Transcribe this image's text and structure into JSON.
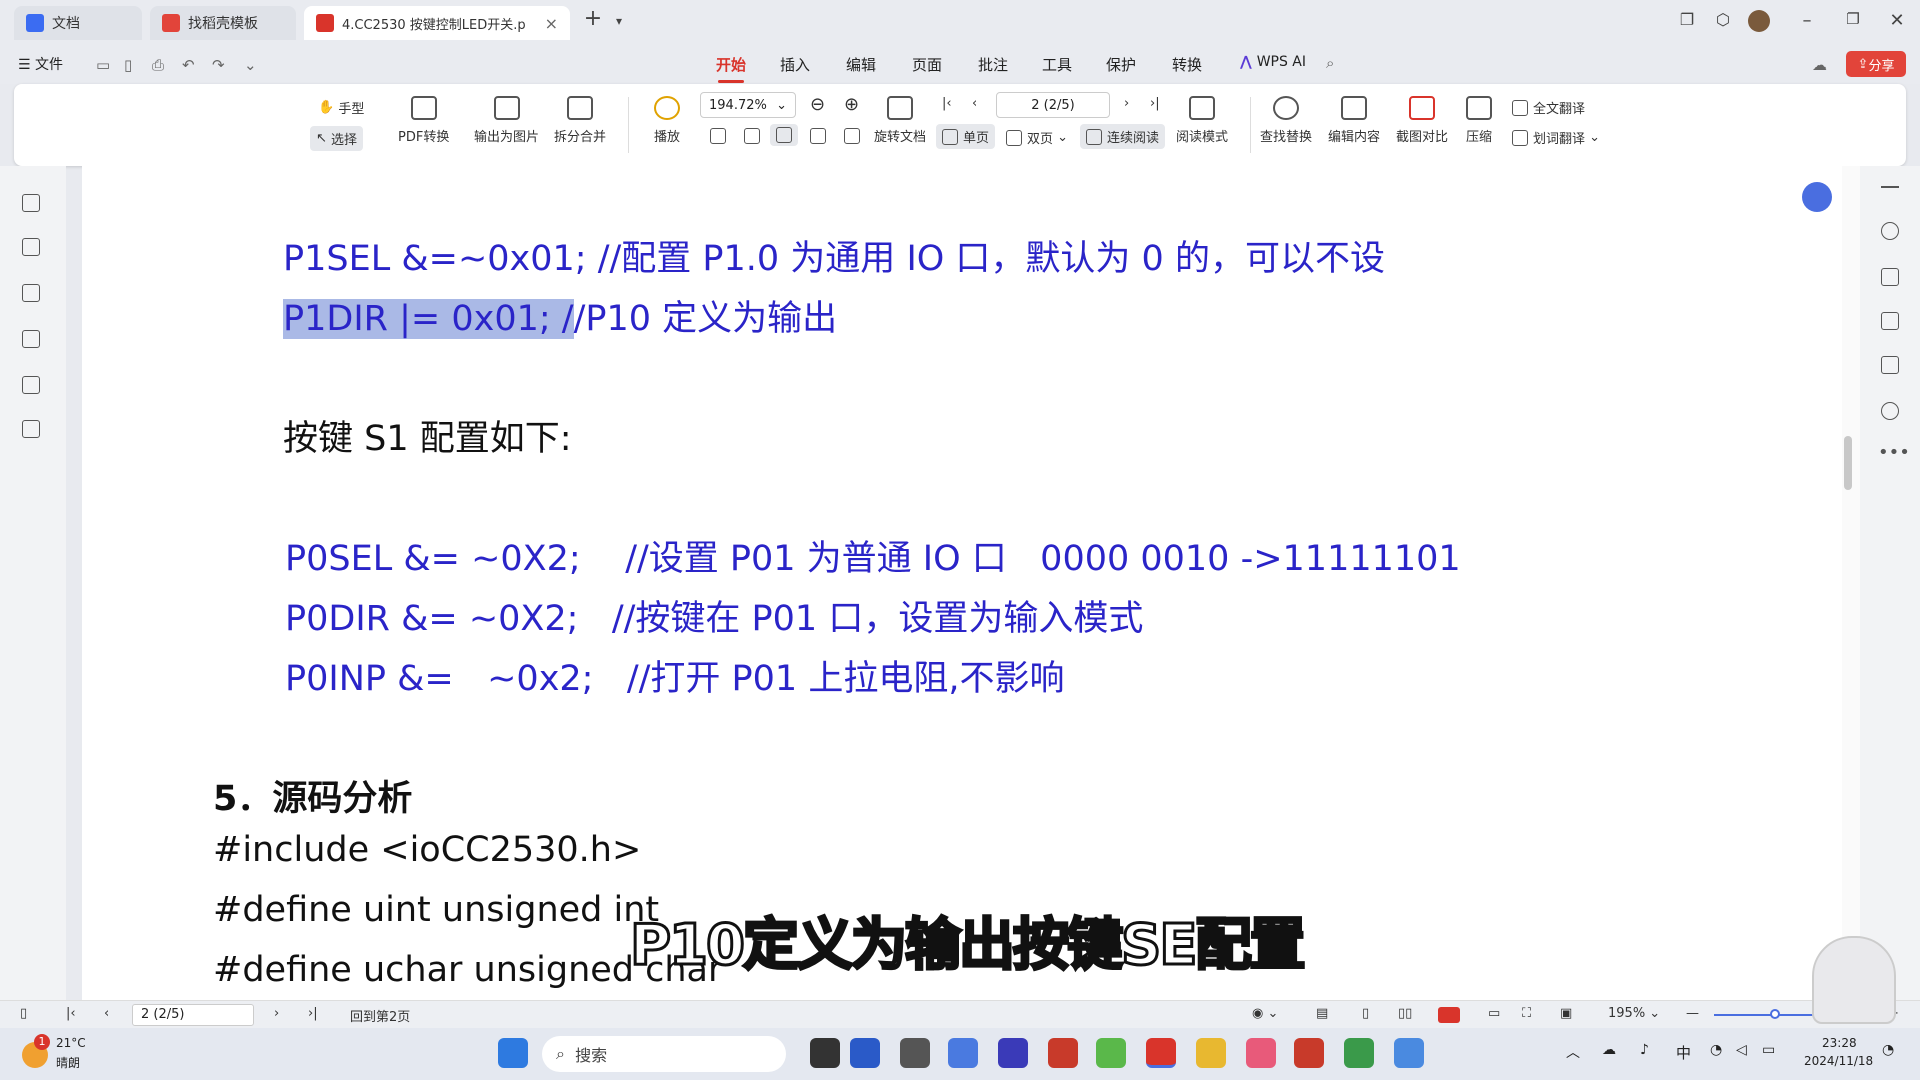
{
  "titlebar": {
    "tabs": [
      {
        "label": "文档",
        "color": "#3b6cf2"
      },
      {
        "label": "找稻壳模板",
        "color": "#e2443a"
      },
      {
        "label": "4.CC2530 按键控制LED开关.p",
        "color": "#d9342b"
      }
    ],
    "new_tab": "+"
  },
  "menubar": {
    "file": "文件",
    "items": [
      "开始",
      "插入",
      "编辑",
      "页面",
      "批注",
      "工具",
      "保护",
      "转换"
    ],
    "ai": "WPS AI",
    "share": "分享"
  },
  "ribbon": {
    "hand": "手型",
    "select": "选择",
    "pdf_convert": "PDF转换",
    "export_image": "输出为图片",
    "split_merge": "拆分合并",
    "play": "播放",
    "zoom": "194.72%",
    "rotate": "旋转文档",
    "page_field": "2 (2/5)",
    "single": "单页",
    "double": "双页",
    "continuous": "连续阅读",
    "read_mode": "阅读模式",
    "find_replace": "查找替换",
    "edit_content": "编辑内容",
    "screenshot_compare": "截图对比",
    "compress": "压缩",
    "full_translate": "全文翻译",
    "word_translate": "划词翻译"
  },
  "document": {
    "line1": "P1SEL &=~0x01; //配置 P1.0 为通用 IO 口，默认为 0 的，可以不设",
    "line2_hl": "P1DIR |= 0x01; /",
    "line2_rest": "/P10 定义为输出",
    "line3": "按键 S1 配置如下:",
    "line4": "P0SEL &= ~0X2;    //设置 P01 为普通 IO 口   0000 0010 ->11111101",
    "line5": "P0DIR &= ~0X2;   //按键在 P01 口，设置为输入模式",
    "line6": "P0INP &=   ~0x2;   //打开 P01 上拉电阻,不影响",
    "heading": "5．源码分析",
    "code1": "#include <ioCC2530.h>",
    "code2": "#define uint unsigned int",
    "code3": "#define uchar unsigned char"
  },
  "subtitle": "P10定义为输出按键SE配置",
  "statusbar": {
    "page": "2 (2/5)",
    "back": "回到第2页",
    "zoom": "195%"
  },
  "taskbar": {
    "weather_temp": "21°C",
    "weather_desc": "晴朗",
    "weather_badge": "1",
    "search": "搜索",
    "ime": "中",
    "time": "23:28",
    "date": "2024/11/18"
  }
}
